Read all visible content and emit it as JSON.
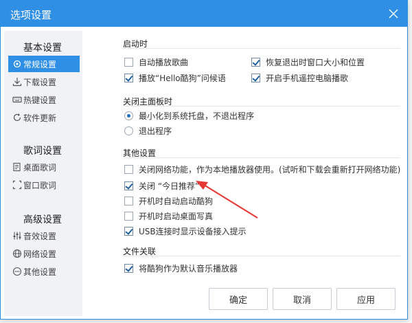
{
  "dialog": {
    "title": "选项设置"
  },
  "sidebar": {
    "groups": [
      {
        "title": "基本设置",
        "items": [
          {
            "label": "常规设置",
            "icon": "gear-icon",
            "active": true
          },
          {
            "label": "下载设置",
            "icon": "download-icon"
          },
          {
            "label": "热键设置",
            "icon": "keyboard-icon"
          },
          {
            "label": "软件更新",
            "icon": "update-icon"
          }
        ]
      },
      {
        "title": "歌词设置",
        "items": [
          {
            "label": "桌面歌词",
            "icon": "desktop-lyrics-icon"
          },
          {
            "label": "窗口歌词",
            "icon": "window-lyrics-icon"
          }
        ]
      },
      {
        "title": "高级设置",
        "items": [
          {
            "label": "音效设置",
            "icon": "equalizer-icon"
          },
          {
            "label": "网络设置",
            "icon": "globe-icon"
          },
          {
            "label": "其他设置",
            "icon": "more-icon"
          }
        ]
      }
    ]
  },
  "sections": {
    "startup": {
      "title": "启动时",
      "options": [
        {
          "label": "自动播放歌曲",
          "checked": false
        },
        {
          "label": "恢复退出时窗口大小和位置",
          "checked": true
        },
        {
          "label": "播放“Hello酷狗”问候语",
          "checked": true
        },
        {
          "label": "开启手机遥控电脑播歌",
          "checked": true
        }
      ]
    },
    "close_panel": {
      "title": "关闭主面板时",
      "options": [
        {
          "label": "最小化到系统托盘，不退出程序",
          "selected": true
        },
        {
          "label": "退出程序",
          "selected": false
        }
      ]
    },
    "other": {
      "title": "其他设置",
      "options": [
        {
          "label": "关闭网络功能，作为本地播放器使用。(试听和下载会重新打开网络功能)",
          "checked": false
        },
        {
          "label": "关闭 “今日推荐”",
          "checked": true
        },
        {
          "label": "开机时自动启动酷狗",
          "checked": false
        },
        {
          "label": "开机时启动桌面写真",
          "checked": false
        },
        {
          "label": "USB连接时显示设备接入提示",
          "checked": true
        }
      ]
    },
    "file_assoc": {
      "title": "文件关联",
      "options": [
        {
          "label": "将酷狗作为默认音乐播放器",
          "checked": true
        }
      ]
    }
  },
  "buttons": {
    "ok": "确定",
    "cancel": "取消",
    "apply": "应用"
  },
  "colors": {
    "accent": "#2f8fe4",
    "arrow": "#e53935"
  }
}
